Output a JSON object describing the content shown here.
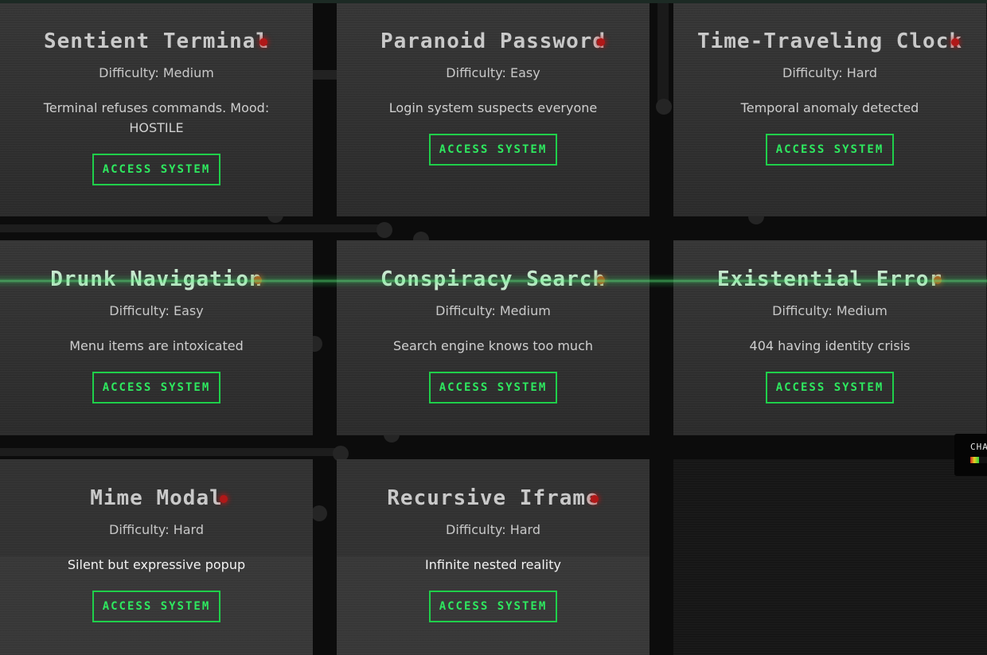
{
  "cards": [
    {
      "title": "Sentient Terminal",
      "difficulty": "Difficulty: Medium",
      "description": "Terminal refuses commands. Mood: HOSTILE",
      "button": "ACCESS SYSTEM"
    },
    {
      "title": "Paranoid Password",
      "difficulty": "Difficulty: Easy",
      "description": "Login system suspects everyone",
      "button": "ACCESS SYSTEM"
    },
    {
      "title": "Time-Traveling Clock",
      "difficulty": "Difficulty: Hard",
      "description": "Temporal anomaly detected",
      "button": "ACCESS SYSTEM"
    },
    {
      "title": "Drunk Navigation",
      "difficulty": "Difficulty: Easy",
      "description": "Menu items are intoxicated",
      "button": "ACCESS SYSTEM"
    },
    {
      "title": "Conspiracy Search",
      "difficulty": "Difficulty: Medium",
      "description": "Search engine knows too much",
      "button": "ACCESS SYSTEM"
    },
    {
      "title": "Existential Error",
      "difficulty": "Difficulty: Medium",
      "description": "404 having identity crisis",
      "button": "ACCESS SYSTEM"
    },
    {
      "title": "Mime Modal",
      "difficulty": "Difficulty: Hard",
      "description": "Silent but expressive popup",
      "button": "ACCESS SYSTEM"
    },
    {
      "title": "Recursive Iframe",
      "difficulty": "Difficulty: Hard",
      "description": "Infinite nested reality",
      "button": "ACCESS SYSTEM"
    }
  ],
  "chaos_meter": {
    "label": "CHA",
    "level": 0.22
  },
  "colors": {
    "accent": "#1fcf4a",
    "status_red": "#b01818",
    "status_orange": "#b8541a"
  }
}
